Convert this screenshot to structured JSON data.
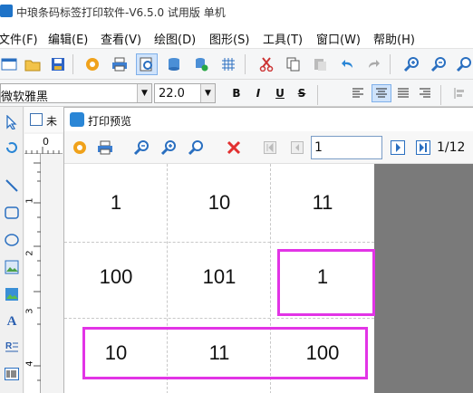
{
  "window": {
    "title": "中琅条码标签打印软件-V6.5.0 试用版 单机"
  },
  "menu": [
    "文件(F)",
    "编辑(E)",
    "查看(V)",
    "绘图(D)",
    "图形(S)",
    "工具(T)",
    "窗口(W)",
    "帮助(H)"
  ],
  "format": {
    "font_name": "微软雅黑",
    "font_size": "22.0",
    "bold": "B",
    "italic": "I",
    "underline": "U",
    "strike": "S"
  },
  "doc_tab": {
    "label": "未"
  },
  "ruler": {
    "top_label": "0",
    "v_labels": [
      "1",
      "2",
      "3",
      "4"
    ]
  },
  "preview": {
    "title": "打印预览",
    "page_input": "1",
    "page_total": "1/12",
    "labels": [
      [
        "1",
        "10",
        "11"
      ],
      [
        "100",
        "101",
        "1"
      ],
      [
        "10",
        "11",
        "100"
      ]
    ]
  },
  "colors": {
    "highlight": "#e234e6",
    "accent": "#1e73c8"
  }
}
